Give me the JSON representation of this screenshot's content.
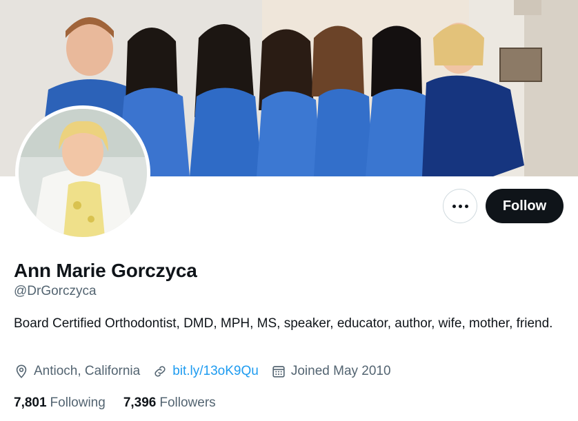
{
  "profile": {
    "name": "Ann Marie Gorczyca",
    "handle": "@DrGorczyca",
    "bio": "Board Certified Orthodontist, DMD, MPH, MS, speaker, educator, author, wife, mother, friend.",
    "location": "Antioch, California",
    "website": "bit.ly/13oK9Qu",
    "joined": "Joined May 2010"
  },
  "actions": {
    "follow_label": "Follow",
    "more_icon": "more-horizontal-icon"
  },
  "stats": {
    "following_count": "7,801",
    "following_label": "Following",
    "followers_count": "7,396",
    "followers_label": "Followers"
  },
  "icons": {
    "location": "location-pin-icon",
    "link": "link-icon",
    "calendar": "calendar-icon"
  },
  "colors": {
    "accent": "#1d9bf0",
    "text_primary": "#0f1419",
    "text_secondary": "#536471",
    "button_dark": "#0f1419"
  }
}
